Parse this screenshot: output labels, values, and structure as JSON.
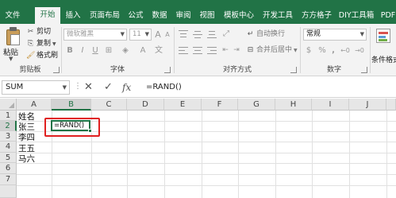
{
  "ribbon_tabs": [
    "文件",
    "开始",
    "插入",
    "页面布局",
    "公式",
    "数据",
    "审阅",
    "视图",
    "模板中心",
    "开发工具",
    "方方格子",
    "DIY工具箱",
    "PDF"
  ],
  "active_tab": "开始",
  "clipboard": {
    "paste": "粘贴",
    "cut": "剪切",
    "copy": "复制",
    "format_painter": "格式刷",
    "label": "剪贴板"
  },
  "font": {
    "font_name": "微软雅黑",
    "font_size": "11",
    "grow": "A",
    "shrink": "A",
    "bold": "B",
    "italic": "I",
    "underline": "U",
    "label": "字体"
  },
  "alignment": {
    "wrap_text": "自动换行",
    "merge_center": "合并后居中",
    "label": "对齐方式"
  },
  "number": {
    "format": "常规",
    "currency": "$",
    "percent": "%",
    "comma": ",",
    "label": "数字"
  },
  "styles": {
    "conditional_format": "条件格式"
  },
  "formula_bar": {
    "name_box": "SUM",
    "cancel_icon": "✕",
    "enter_icon": "✓",
    "fx": "fx",
    "formula": "=RAND()"
  },
  "columns": [
    "A",
    "B",
    "C",
    "D",
    "E",
    "F",
    "G",
    "H",
    "I",
    "J"
  ],
  "rows": [
    "1",
    "2",
    "3",
    "4",
    "5",
    "6",
    "7"
  ],
  "cells": {
    "A1": "姓名",
    "A2": "张三",
    "A3": "李四",
    "A4": "王五",
    "A5": "马六",
    "B2": "=RAND()"
  },
  "active_cell": "B2",
  "colors": {
    "accent": "#217346",
    "highlight": "#e02020"
  }
}
